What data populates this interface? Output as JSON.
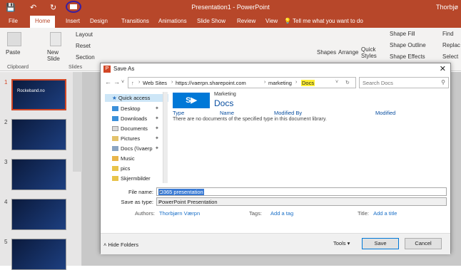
{
  "app": {
    "title": "Presentation1 - PowerPoint",
    "user": "Thorbjø",
    "brand_color": "#b7472a"
  },
  "quick_access": {
    "save_icon": "save-icon",
    "undo_icon": "undo-icon",
    "redo_icon": "redo-icon",
    "present_icon": "present-from-beginning-icon"
  },
  "tabs": [
    "File",
    "Home",
    "Insert",
    "Design",
    "Transitions",
    "Animations",
    "Slide Show",
    "Review",
    "View"
  ],
  "tellme": "Tell me what you want to do",
  "ribbon": {
    "paste": "Paste",
    "clipboard": "Clipboard",
    "new_slide": "New Slide",
    "layout": "Layout",
    "reset": "Reset",
    "section": "Section",
    "slides": "Slides",
    "shapes": "Shapes",
    "arrange": "Arrange",
    "quick_styles": "Quick Styles",
    "shape_fill": "Shape Fill",
    "shape_outline": "Shape Outline",
    "shape_effects": "Shape Effects",
    "find": "Find",
    "replace": "Replac",
    "select": "Select"
  },
  "slides": [
    {
      "num": "1",
      "title": "Rockeband.no"
    },
    {
      "num": "2",
      "title": ""
    },
    {
      "num": "3",
      "title": ""
    },
    {
      "num": "4",
      "title": ""
    },
    {
      "num": "5",
      "title": ""
    }
  ],
  "dialog": {
    "title": "Save As",
    "breadcrumb": [
      "Web Sites",
      "https://vaerpn.sharepoint.com",
      "marketing",
      "Docs"
    ],
    "search_placeholder": "Search Docs",
    "tree_header": "Quick access",
    "tree": [
      "Desktop",
      "Downloads",
      "Documents",
      "Pictures",
      "Docs (\\\\vaerp",
      "Music",
      "pics",
      "Skjermbilder"
    ],
    "site_name": "Marketing",
    "library_name": "Docs",
    "columns": [
      "Type",
      "Name",
      "Modified By",
      "Modified"
    ],
    "empty_message": "There are no documents of the specified type in this document library.",
    "file_name_label": "File name:",
    "file_name_value": "O365 presentation",
    "save_type_label": "Save as type:",
    "save_type_value": "PowerPoint Presentation",
    "authors_label": "Authors:",
    "authors_value": "Thorbjørn Værpn",
    "tags_label": "Tags:",
    "tags_value": "Add a tag",
    "title_label": "Title:",
    "title_value": "Add a title",
    "hide_folders": "Hide Folders",
    "tools": "Tools",
    "save": "Save",
    "cancel": "Cancel"
  }
}
